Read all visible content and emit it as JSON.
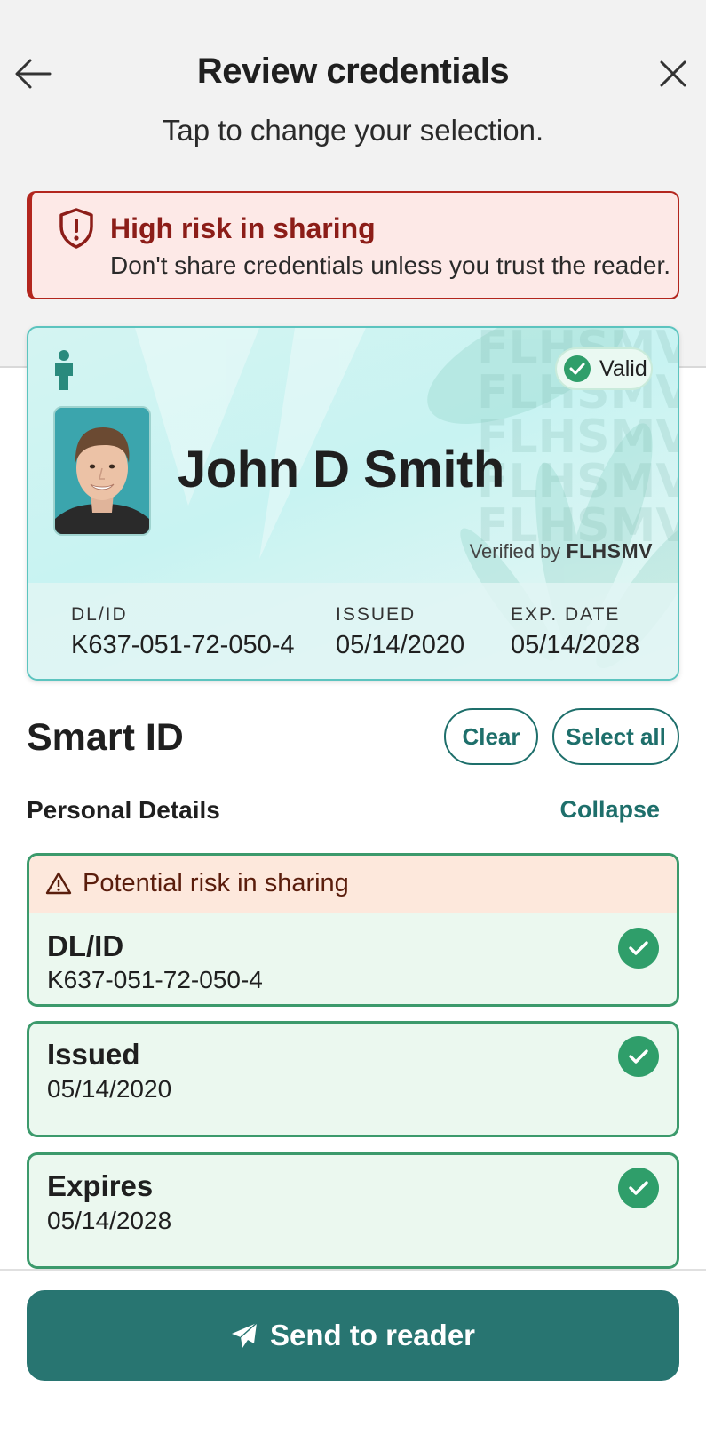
{
  "header": {
    "title": "Review credentials",
    "subtitle": "Tap to change your selection.",
    "back_icon": "arrow-left-icon",
    "close_icon": "close-icon"
  },
  "alert": {
    "title": "High risk in sharing",
    "message": "Don't share credentials unless you trust the reader.",
    "icon": "shield-alert-icon",
    "color": "#b3261e"
  },
  "card": {
    "status": "Valid",
    "holder_name": "John D Smith",
    "verified_prefix": "Verified by",
    "issuer": "FLHSMV",
    "watermark": "FLHSMV",
    "fields": [
      {
        "label": "DL/ID",
        "value": "K637-051-72-050-4"
      },
      {
        "label": "ISSUED",
        "value": "05/14/2020"
      },
      {
        "label": "EXP. DATE",
        "value": "05/14/2028"
      }
    ],
    "accent": "#5cc4bf"
  },
  "section": {
    "title": "Smart ID",
    "clear_label": "Clear",
    "select_all_label": "Select all",
    "group_title": "Personal Details",
    "collapse_label": "Collapse"
  },
  "items": [
    {
      "warning": "Potential risk in sharing",
      "label": "DL/ID",
      "value": "K637-051-72-050-4",
      "selected": true
    },
    {
      "label": "Issued",
      "value": "05/14/2020",
      "selected": true
    },
    {
      "label": "Expires",
      "value": "05/14/2028",
      "selected": true
    }
  ],
  "footer": {
    "send_label": "Send to reader",
    "send_icon": "paper-plane-icon",
    "color": "#287571"
  }
}
